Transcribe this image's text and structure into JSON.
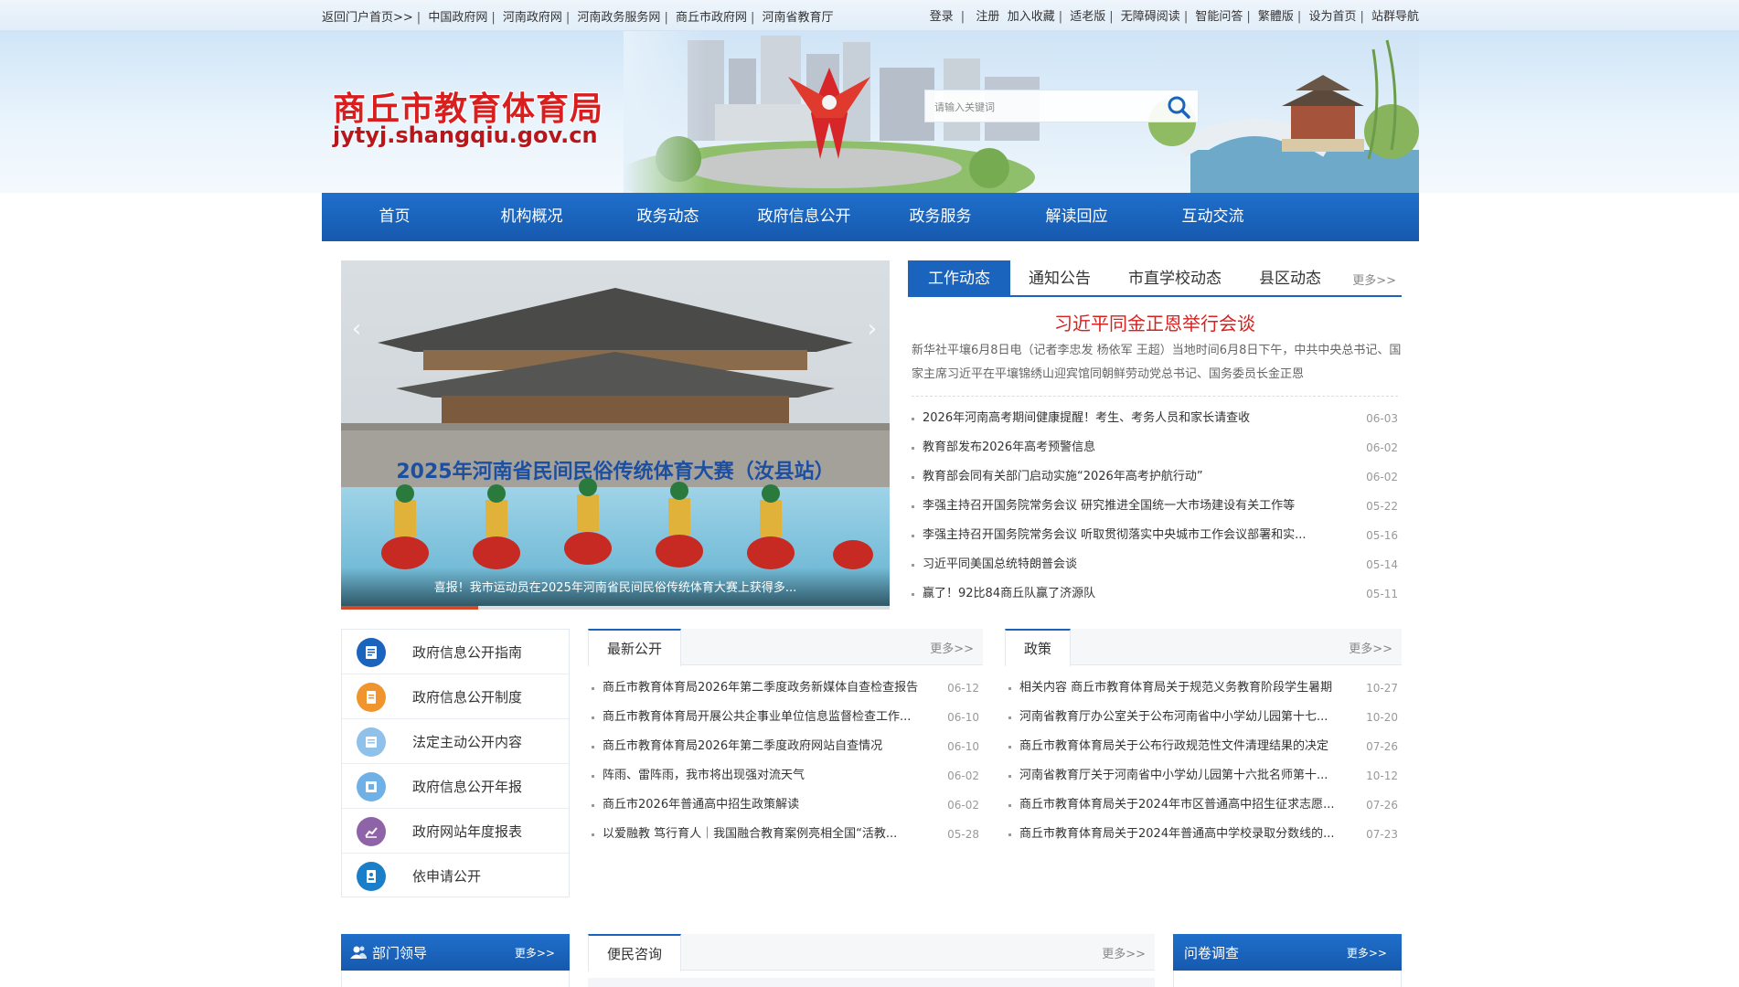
{
  "topbar": {
    "left_links": [
      "返回门户首页>>",
      "中国政府网",
      "河南政府网",
      "河南政务服务网",
      "商丘市政府网",
      "河南省教育厅"
    ],
    "login": "登录",
    "register": "注册",
    "right_links": [
      "加入收藏",
      "适老版",
      "无障碍阅读",
      "智能问答",
      "繁體版",
      "设为首页",
      "站群导航"
    ]
  },
  "header": {
    "title": "商丘市教育体育局",
    "domain": "jytyj.shangqiu.gov.cn",
    "search_placeholder": "请输入关键词"
  },
  "nav": {
    "items": [
      "首页",
      "机构概况",
      "政务动态",
      "政府信息公开",
      "政务服务",
      "解读回应",
      "互动交流"
    ]
  },
  "slider": {
    "banner_text": "2025年河南省民间民俗传统体育大赛（汝县站）",
    "caption": "喜报！我市运动员在2025年河南省民间民俗传统体育大赛上获得多...",
    "progress": 0.25
  },
  "news": {
    "tabs": [
      "工作动态",
      "通知公告",
      "市直学校动态",
      "县区动态"
    ],
    "more": "更多>>",
    "headline": "习近平同金正恩举行会谈",
    "summary": "新华社平壤6月8日电（记者李忠发 杨依军 王超）当地时间6月8日下午，中共中央总书记、国家主席习近平在平壤锦绣山迎宾馆同朝鲜劳动党总书记、国务委员长金正恩",
    "items": [
      {
        "title": "2026年河南高考期间健康提醒！考生、考务人员和家长请查收",
        "date": "06-03"
      },
      {
        "title": "教育部发布2026年高考预警信息",
        "date": "06-02"
      },
      {
        "title": "教育部会同有关部门启动实施“2026年高考护航行动”",
        "date": "06-02"
      },
      {
        "title": "李强主持召开国务院常务会议 研究推进全国统一大市场建设有关工作等",
        "date": "05-22"
      },
      {
        "title": "李强主持召开国务院常务会议 听取贯彻落实中央城市工作会议部署和实...",
        "date": "05-16"
      },
      {
        "title": "习近平同美国总统特朗普会谈",
        "date": "05-14"
      },
      {
        "title": "赢了！92比84商丘队赢了济源队",
        "date": "05-11"
      }
    ]
  },
  "quick_menu": {
    "items": [
      {
        "label": "政府信息公开指南",
        "color": "#1a64bd"
      },
      {
        "label": "政府信息公开制度",
        "color": "#f0952e"
      },
      {
        "label": "法定主动公开内容",
        "color": "#8fc1ea"
      },
      {
        "label": "政府信息公开年报",
        "color": "#6fb1e6"
      },
      {
        "label": "政府网站年度报表",
        "color": "#8e63a8"
      },
      {
        "label": "依申请公开",
        "color": "#1a7fc8"
      }
    ]
  },
  "latest": {
    "title": "最新公开",
    "more": "更多>>",
    "items": [
      {
        "title": "商丘市教育体育局2026年第二季度政务新媒体自查检查报告",
        "date": "06-12"
      },
      {
        "title": "商丘市教育体育局开展公共企事业单位信息监督检查工作...",
        "date": "06-10"
      },
      {
        "title": "商丘市教育体育局2026年第二季度政府网站自查情况",
        "date": "06-10"
      },
      {
        "title": "阵雨、雷阵雨，我市将出现强对流天气",
        "date": "06-02"
      },
      {
        "title": "商丘市2026年普通高中招生政策解读",
        "date": "06-02"
      },
      {
        "title": "以爱融教 笃行育人｜我国融合教育案例亮相全国“活教...",
        "date": "05-28"
      }
    ]
  },
  "policy": {
    "title": "政策",
    "more": "更多>>",
    "items": [
      {
        "title": "相关内容 商丘市教育体育局关于规范义务教育阶段学生暑期",
        "date": "10-27"
      },
      {
        "title": "河南省教育厅办公室关于公布河南省中小学幼儿园第十七...",
        "date": "10-20"
      },
      {
        "title": "商丘市教育体育局关于公布行政规范性文件清理结果的决定",
        "date": "07-26"
      },
      {
        "title": "河南省教育厅关于河南省中小学幼儿园第十六批名师第十...",
        "date": "10-12"
      },
      {
        "title": "商丘市教育体育局关于2024年市区普通高中招生征求志愿...",
        "date": "07-26"
      },
      {
        "title": "商丘市教育体育局关于2024年普通高中学校录取分数线的...",
        "date": "07-23"
      }
    ]
  },
  "bottom": {
    "leaders": {
      "title": "部门领导",
      "more": "更多>>"
    },
    "consult": {
      "title": "便民咨询",
      "more": "更多>>"
    },
    "survey": {
      "title": "问卷调查",
      "more": "更多>>"
    }
  },
  "colors": {
    "primary": "#1a64bd",
    "headline_red": "#d8201e",
    "logo_red": "#d81e1e"
  }
}
